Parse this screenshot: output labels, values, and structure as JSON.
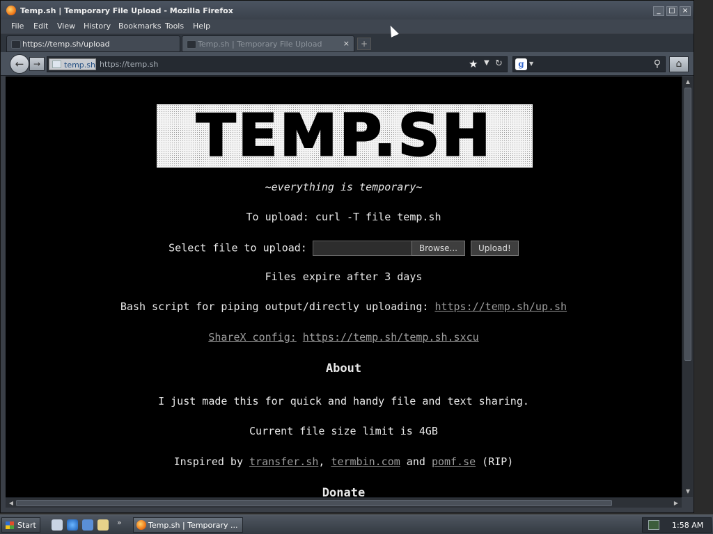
{
  "window": {
    "title": "Temp.sh | Temporary File Upload - Mozilla Firefox",
    "controls": [
      "_",
      "□",
      "×"
    ]
  },
  "menu": [
    "File",
    "Edit",
    "View",
    "History",
    "Bookmarks",
    "Tools",
    "Help"
  ],
  "tabs": [
    {
      "label": "https://temp.sh/upload",
      "active": false
    },
    {
      "label": "Temp.sh | Temporary File Upload",
      "active": true
    }
  ],
  "navbar": {
    "site_identity": "temp.sh",
    "url": "https://temp.sh",
    "search_engine": "g"
  },
  "page": {
    "logo_text": "TEMP.SH",
    "tagline": "~everything is temporary~",
    "curl_line": "To upload: curl -T file temp.sh",
    "select_label": "Select file to upload:",
    "browse_label": "Browse...",
    "upload_label": "Upload!",
    "expire_line": "Files expire after 3 days",
    "bash_text": "Bash script for piping output/directly uploading: ",
    "bash_link": "https://temp.sh/up.sh",
    "sharex_label": "ShareX config:",
    "sharex_link": "https://temp.sh/temp.sh.sxcu",
    "about_heading": "About",
    "made_line": "I just made this for quick and handy file and text sharing.",
    "limit_line": "Current file size limit is 4GB",
    "inspired_prefix": "Inspired by ",
    "inspired_links": [
      "transfer.sh",
      "termbin.com",
      "pomf.se"
    ],
    "inspired_sep1": ", ",
    "inspired_sep2": " and ",
    "inspired_suffix": " (RIP)",
    "donate_heading": "Donate"
  },
  "taskbar": {
    "start_label": "Start",
    "quicklaunch_more": "»",
    "task_label": "Temp.sh | Temporary ...",
    "clock": "1:58 AM"
  },
  "colors": {
    "content_bg": "#000000",
    "content_text": "#e8e8e8",
    "link": "#9c9c9c",
    "chrome": "#3a3f47"
  }
}
